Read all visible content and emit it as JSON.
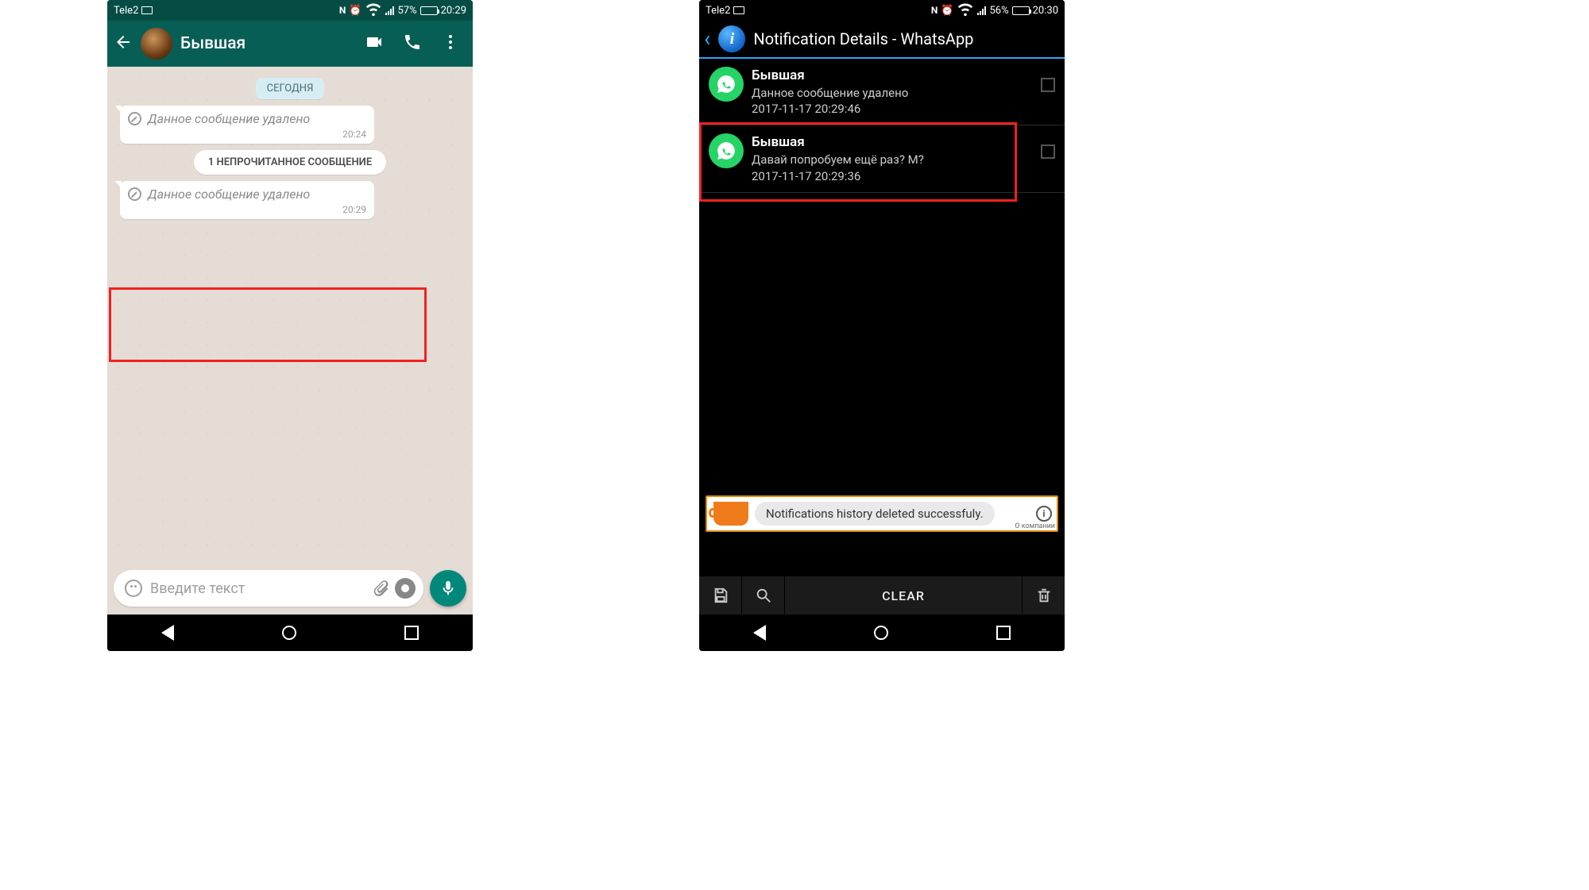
{
  "left": {
    "statusbar": {
      "carrier": "Tele2",
      "battery_pct": "57%",
      "time": "20:29"
    },
    "header": {
      "contact_name": "Бывшая"
    },
    "chat": {
      "date_label": "СЕГОДНЯ",
      "messages": [
        {
          "text": "Данное сообщение удалено",
          "time": "20:24"
        },
        {
          "text": "Данное сообщение удалено",
          "time": "20:29"
        }
      ],
      "unread_banner": "1 НЕПРОЧИТАННОЕ СООБЩЕНИЕ"
    },
    "input": {
      "placeholder": "Введите текст"
    }
  },
  "right": {
    "statusbar": {
      "carrier": "Tele2",
      "battery_pct": "56%",
      "time": "20:30"
    },
    "header": {
      "title": "Notification Details - WhatsApp"
    },
    "notifications": [
      {
        "sender": "Бывшая",
        "body": "Данное сообщение удалено",
        "ts": "2017-11-17 20:29:46"
      },
      {
        "sender": "Бывшая",
        "body": "Давай попробуем ещё раз? М?",
        "ts": "2017-11-17 20:29:36"
      }
    ],
    "toast": "Notifications history deleted successfuly.",
    "toast_corner": "О компании",
    "bottombar": {
      "clear": "CLEAR"
    }
  }
}
